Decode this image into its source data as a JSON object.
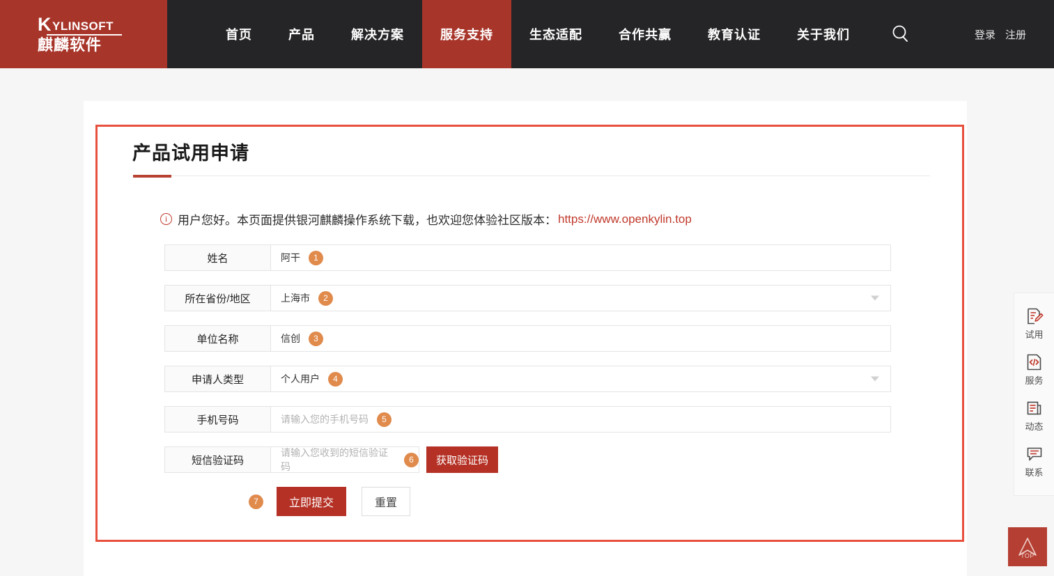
{
  "nav": {
    "logo": {
      "top_big": "K",
      "top_rest": "YLINSOFT",
      "bottom": "麒麟软件"
    },
    "items": [
      {
        "label": "首页",
        "active": false
      },
      {
        "label": "产品",
        "active": false
      },
      {
        "label": "解决方案",
        "active": false
      },
      {
        "label": "服务支持",
        "active": true
      },
      {
        "label": "生态适配",
        "active": false
      },
      {
        "label": "合作共赢",
        "active": false
      },
      {
        "label": "教育认证",
        "active": false
      },
      {
        "label": "关于我们",
        "active": false
      }
    ],
    "search_icon": "search-icon",
    "login": "登录",
    "register": "注册"
  },
  "form": {
    "title": "产品试用申请",
    "notice_icon": "info-circle-icon",
    "notice_text": "用户您好。本页面提供银河麒麟操作系统下载，也欢迎您体验社区版本：",
    "notice_link": "https://www.openkylin.top",
    "rows": [
      {
        "label": "姓名",
        "value": "阿干",
        "placeholder": "",
        "badge": "1",
        "type": "text"
      },
      {
        "label": "所在省份/地区",
        "value": "上海市",
        "placeholder": "",
        "badge": "2",
        "type": "select"
      },
      {
        "label": "单位名称",
        "value": "信创",
        "placeholder": "",
        "badge": "3",
        "type": "text"
      },
      {
        "label": "申请人类型",
        "value": "个人用户",
        "placeholder": "",
        "badge": "4",
        "type": "select"
      },
      {
        "label": "手机号码",
        "value": "",
        "placeholder": "请输入您的手机号码",
        "badge": "5",
        "type": "text"
      },
      {
        "label": "短信验证码",
        "value": "",
        "placeholder": "请输入您收到的短信验证码",
        "badge": "6",
        "type": "code"
      }
    ],
    "get_code_label": "获取验证码",
    "submit_badge": "7",
    "submit_label": "立即提交",
    "reset_label": "重置"
  },
  "rail": {
    "items": [
      {
        "label": "试用",
        "icon": "trial-pencil-doc-icon"
      },
      {
        "label": "服务",
        "icon": "code-doc-icon"
      },
      {
        "label": "动态",
        "icon": "news-doc-icon"
      },
      {
        "label": "联系",
        "icon": "chat-bubble-icon"
      }
    ],
    "top_button_label": "TOP",
    "top_button_icon": "arrow-up-icon"
  },
  "colors": {
    "brand_red": "#A8352A",
    "button_red": "#B53125",
    "badge_orange": "#E08A4C",
    "highlight_border": "#E8503E",
    "nav_dark": "#252528"
  }
}
